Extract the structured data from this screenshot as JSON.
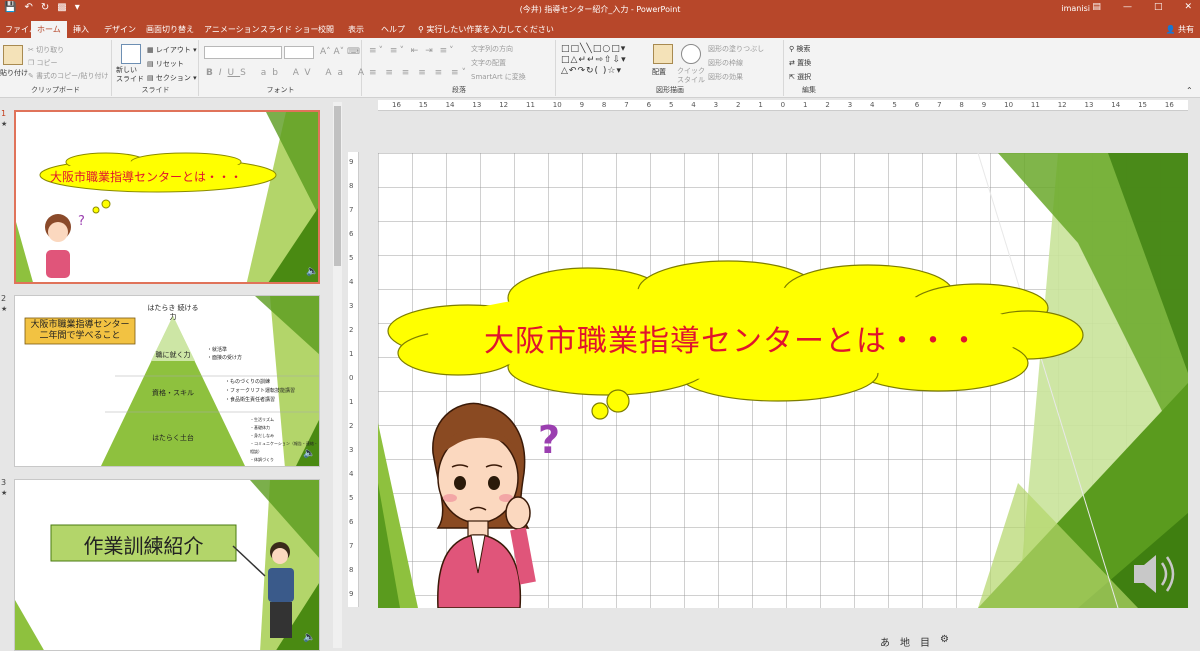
{
  "app": {
    "window_title": "(今井) 指導センター紹介_入力 - PowerPoint",
    "user": "imanisi",
    "quick_access": [
      "save-icon",
      "undo-icon",
      "redo-icon",
      "start-icon",
      "customize-icon"
    ]
  },
  "tabs": [
    "ファイル",
    "ホーム",
    "挿入",
    "デザイン",
    "画面切り替え",
    "アニメーション",
    "スライド ショー",
    "校閲",
    "表示",
    "ヘルプ"
  ],
  "active_tab": "ホーム",
  "tell_me": "実行したい作業を入力してください",
  "share": "共有",
  "ribbon": {
    "clipboard": {
      "label": "クリップボード",
      "paste": "貼り付け",
      "cut": "切り取り",
      "copy": "コピー",
      "format_painter": "書式のコピー/貼り付け"
    },
    "slides": {
      "label": "スライド",
      "new_slide": "新しい スライド",
      "layout": "レイアウト",
      "reset": "リセット",
      "section": "セクション"
    },
    "font": {
      "label": "フォント",
      "font_name": "",
      "font_size": "",
      "buttons": [
        "B",
        "I",
        "U",
        "S",
        "ab",
        "AV",
        "Aa",
        "A"
      ]
    },
    "paragraph": {
      "label": "段落",
      "text_direction": "文字列の方向",
      "align_text": "文字の配置",
      "smartart": "SmartArt に変換"
    },
    "drawing": {
      "label": "図形描画",
      "arrange": "配置",
      "quick_styles": "クイック スタイル",
      "shape_fill": "図形の塗りつぶし",
      "shape_outline": "図形の枠線",
      "shape_effects": "図形の効果"
    },
    "editing": {
      "label": "編集",
      "find": "検索",
      "replace": "置換",
      "select": "選択"
    }
  },
  "thumbnails": [
    {
      "num": "1",
      "title": "大阪市職業指導センターとは・・・"
    },
    {
      "num": "2",
      "box": "大阪市職業指導センター 二年間で学べること",
      "levels": [
        "はたらき 続ける力",
        "職に就く力",
        "資格・スキル",
        "はたらく土台"
      ],
      "bullets1": [
        "・就活準",
        "・面接の受け方"
      ],
      "bullets2": [
        "・ものづくりの訓練",
        "・フォークリフト運転技能講習",
        "・食品衛生責任者講習"
      ],
      "bullets3": [
        "・生活リズム",
        "・基礎体力",
        "・身だしなみ",
        "・コミュニケーション（報告・連絡・相談）",
        "・体調づくり"
      ]
    },
    {
      "num": "3",
      "title": "作業訓練紹介"
    }
  ],
  "main_slide": {
    "title": "大阪市職業指導センターとは・・・",
    "question_mark": "?"
  },
  "ruler": {
    "h_labels": [
      "16",
      "15",
      "14",
      "13",
      "12",
      "11",
      "10",
      "9",
      "8",
      "7",
      "6",
      "5",
      "4",
      "3",
      "2",
      "1",
      "0",
      "1",
      "2",
      "3",
      "4",
      "5",
      "6",
      "7",
      "8",
      "9",
      "10",
      "11",
      "12",
      "13",
      "14",
      "15",
      "16"
    ],
    "v_labels": [
      "9",
      "8",
      "7",
      "6",
      "5",
      "4",
      "3",
      "2",
      "1",
      "0",
      "1",
      "2",
      "3",
      "4",
      "5",
      "6",
      "7",
      "8",
      "9"
    ]
  },
  "status_icons": [
    "あ",
    "地",
    "目",
    "設"
  ],
  "colors": {
    "accent": "#b7472a",
    "title_red": "#e0142d",
    "cloud_yellow": "#ffff00",
    "green_dark": "#5a9b1e",
    "green_light": "#b3d56a"
  }
}
